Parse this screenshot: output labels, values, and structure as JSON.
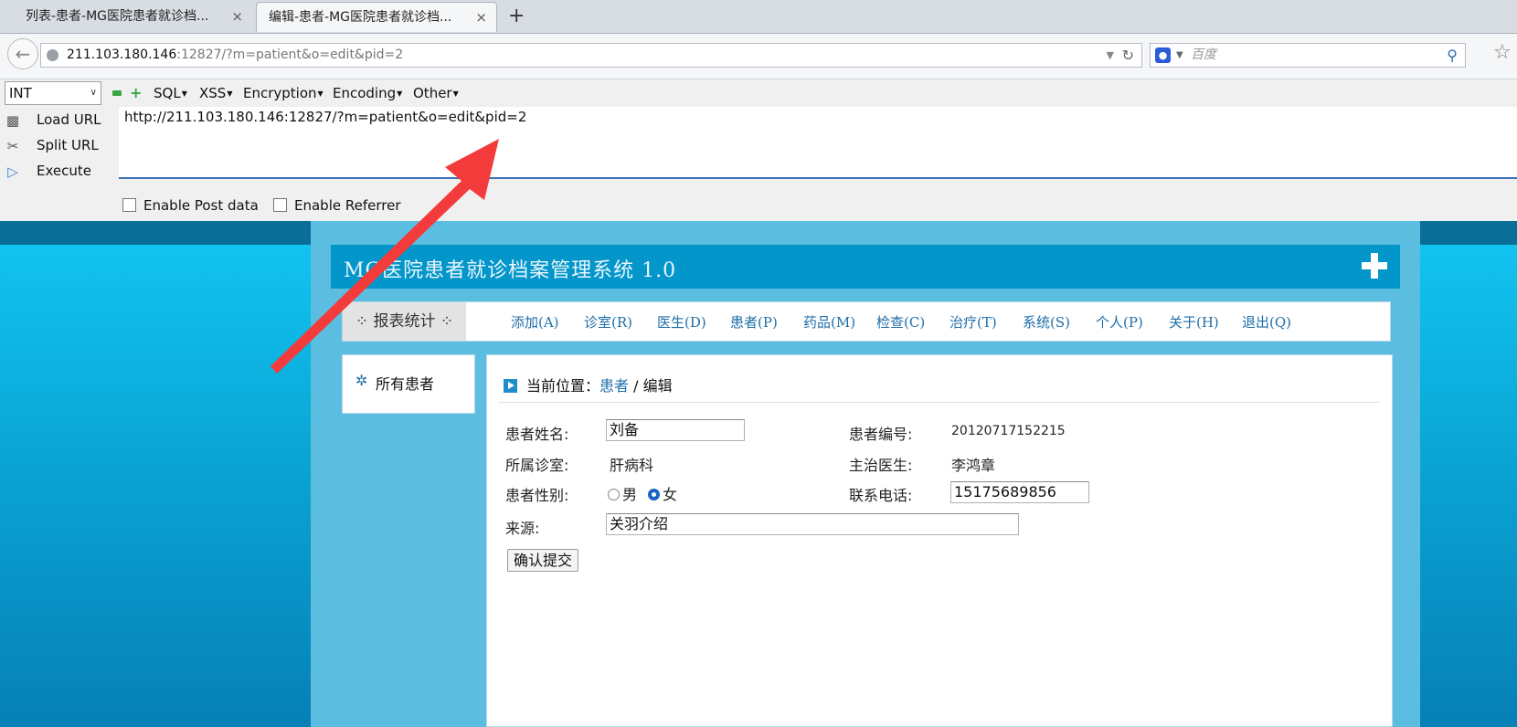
{
  "browser": {
    "tabs": [
      {
        "label": "列表-患者-MG医院患者就诊档...",
        "active": false
      },
      {
        "label": "编辑-患者-MG医院患者就诊档...",
        "active": true
      }
    ],
    "tab_close": "×",
    "new_tab": "+",
    "address": {
      "host": "211.103.180.146",
      "rest": ":12827/?m=patient&o=edit&pid=2"
    },
    "search_placeholder": "百度"
  },
  "hackbar": {
    "select_value": "INT",
    "menus": [
      "SQL",
      "XSS",
      "Encryption",
      "Encoding",
      "Other"
    ],
    "actions": [
      "Load URL",
      "Split URL",
      "Execute"
    ],
    "url_text": "http://211.103.180.146:12827/?m=patient&o=edit&pid=2",
    "checkboxes": [
      "Enable Post data",
      "Enable Referrer"
    ]
  },
  "app": {
    "title": "MG医院患者就诊档案管理系统 1.0",
    "report_tab": "⁘ 报表统计 ⁘",
    "nav": [
      "添加(A)",
      "诊室(R)",
      "医生(D)",
      "患者(P)",
      "药品(M)",
      "检查(C)",
      "治疗(T)",
      "系统(S)",
      "个人(P)",
      "关于(H)",
      "退出(Q)"
    ],
    "sidebar_item": "所有患者",
    "breadcrumb": {
      "prefix": "当前位置：",
      "link": "患者",
      "sep": " / ",
      "current": "编辑"
    }
  },
  "form": {
    "name_label": "患者姓名:",
    "name_value": "刘备",
    "number_label": "患者编号:",
    "number_value": "20120717152215",
    "dept_label": "所属诊室:",
    "dept_value": "肝病科",
    "doctor_label": "主治医生:",
    "doctor_value": "李鸿章",
    "gender_label": "患者性别:",
    "gender_male": "男",
    "gender_female": "女",
    "gender_selected": "女",
    "phone_label": "联系电话:",
    "phone_value": "15175689856",
    "source_label": "来源:",
    "source_value": "关羽介绍",
    "submit_label": "确认提交"
  },
  "colors": {
    "header_blue": "#0396ca",
    "nav_link": "#1e6ea8",
    "annotation_arrow": "#f43b3b"
  }
}
